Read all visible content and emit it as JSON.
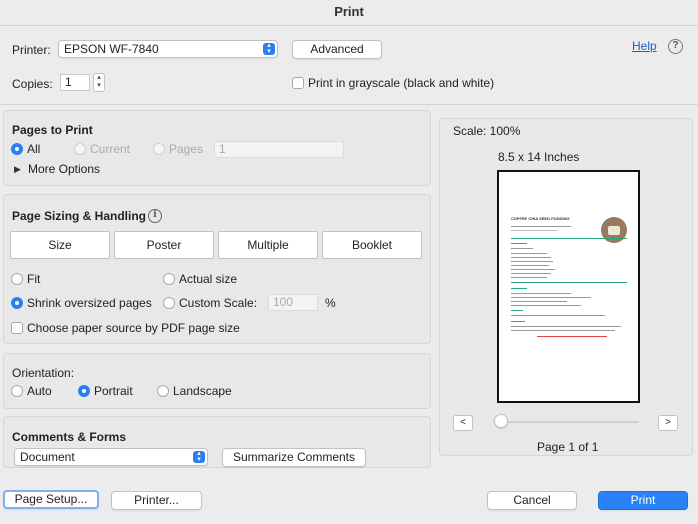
{
  "window": {
    "title": "Print"
  },
  "printer": {
    "label": "Printer:",
    "value": "EPSON WF-7840",
    "advanced_button": "Advanced",
    "help_link": "Help",
    "help_icon": "?"
  },
  "copies": {
    "label": "Copies:",
    "value": "1",
    "grayscale_label": "Print in grayscale (black and white)"
  },
  "pages_to_print": {
    "title": "Pages to Print",
    "all": "All",
    "current": "Current",
    "pages": "Pages",
    "pages_placeholder": "1",
    "more_options": "More Options"
  },
  "page_sizing": {
    "title": "Page Sizing & Handling",
    "info_icon": "i",
    "tabs": [
      "Size",
      "Poster",
      "Multiple",
      "Booklet"
    ],
    "fit": "Fit",
    "actual_size": "Actual size",
    "shrink": "Shrink oversized pages",
    "custom_scale": "Custom Scale:",
    "custom_scale_value": "100",
    "percent": "%",
    "choose_source": "Choose paper source by PDF page size"
  },
  "orientation": {
    "title": "Orientation:",
    "auto": "Auto",
    "portrait": "Portrait",
    "landscape": "Landscape"
  },
  "comments": {
    "title": "Comments & Forms",
    "value": "Document",
    "summarize_button": "Summarize Comments"
  },
  "preview": {
    "scale": "Scale: 100%",
    "paper_size": "8.5 x 14 Inches",
    "prev": "<",
    "next": ">",
    "page_info": "Page 1 of 1",
    "slider_level": 0,
    "doc_title": "COFFEE CHIA SEED PUDDING"
  },
  "footer": {
    "page_setup": "Page Setup...",
    "printer": "Printer...",
    "cancel": "Cancel",
    "print": "Print"
  },
  "colors": {
    "accent": "#2a7ef2",
    "link": "#1a5fd0"
  }
}
